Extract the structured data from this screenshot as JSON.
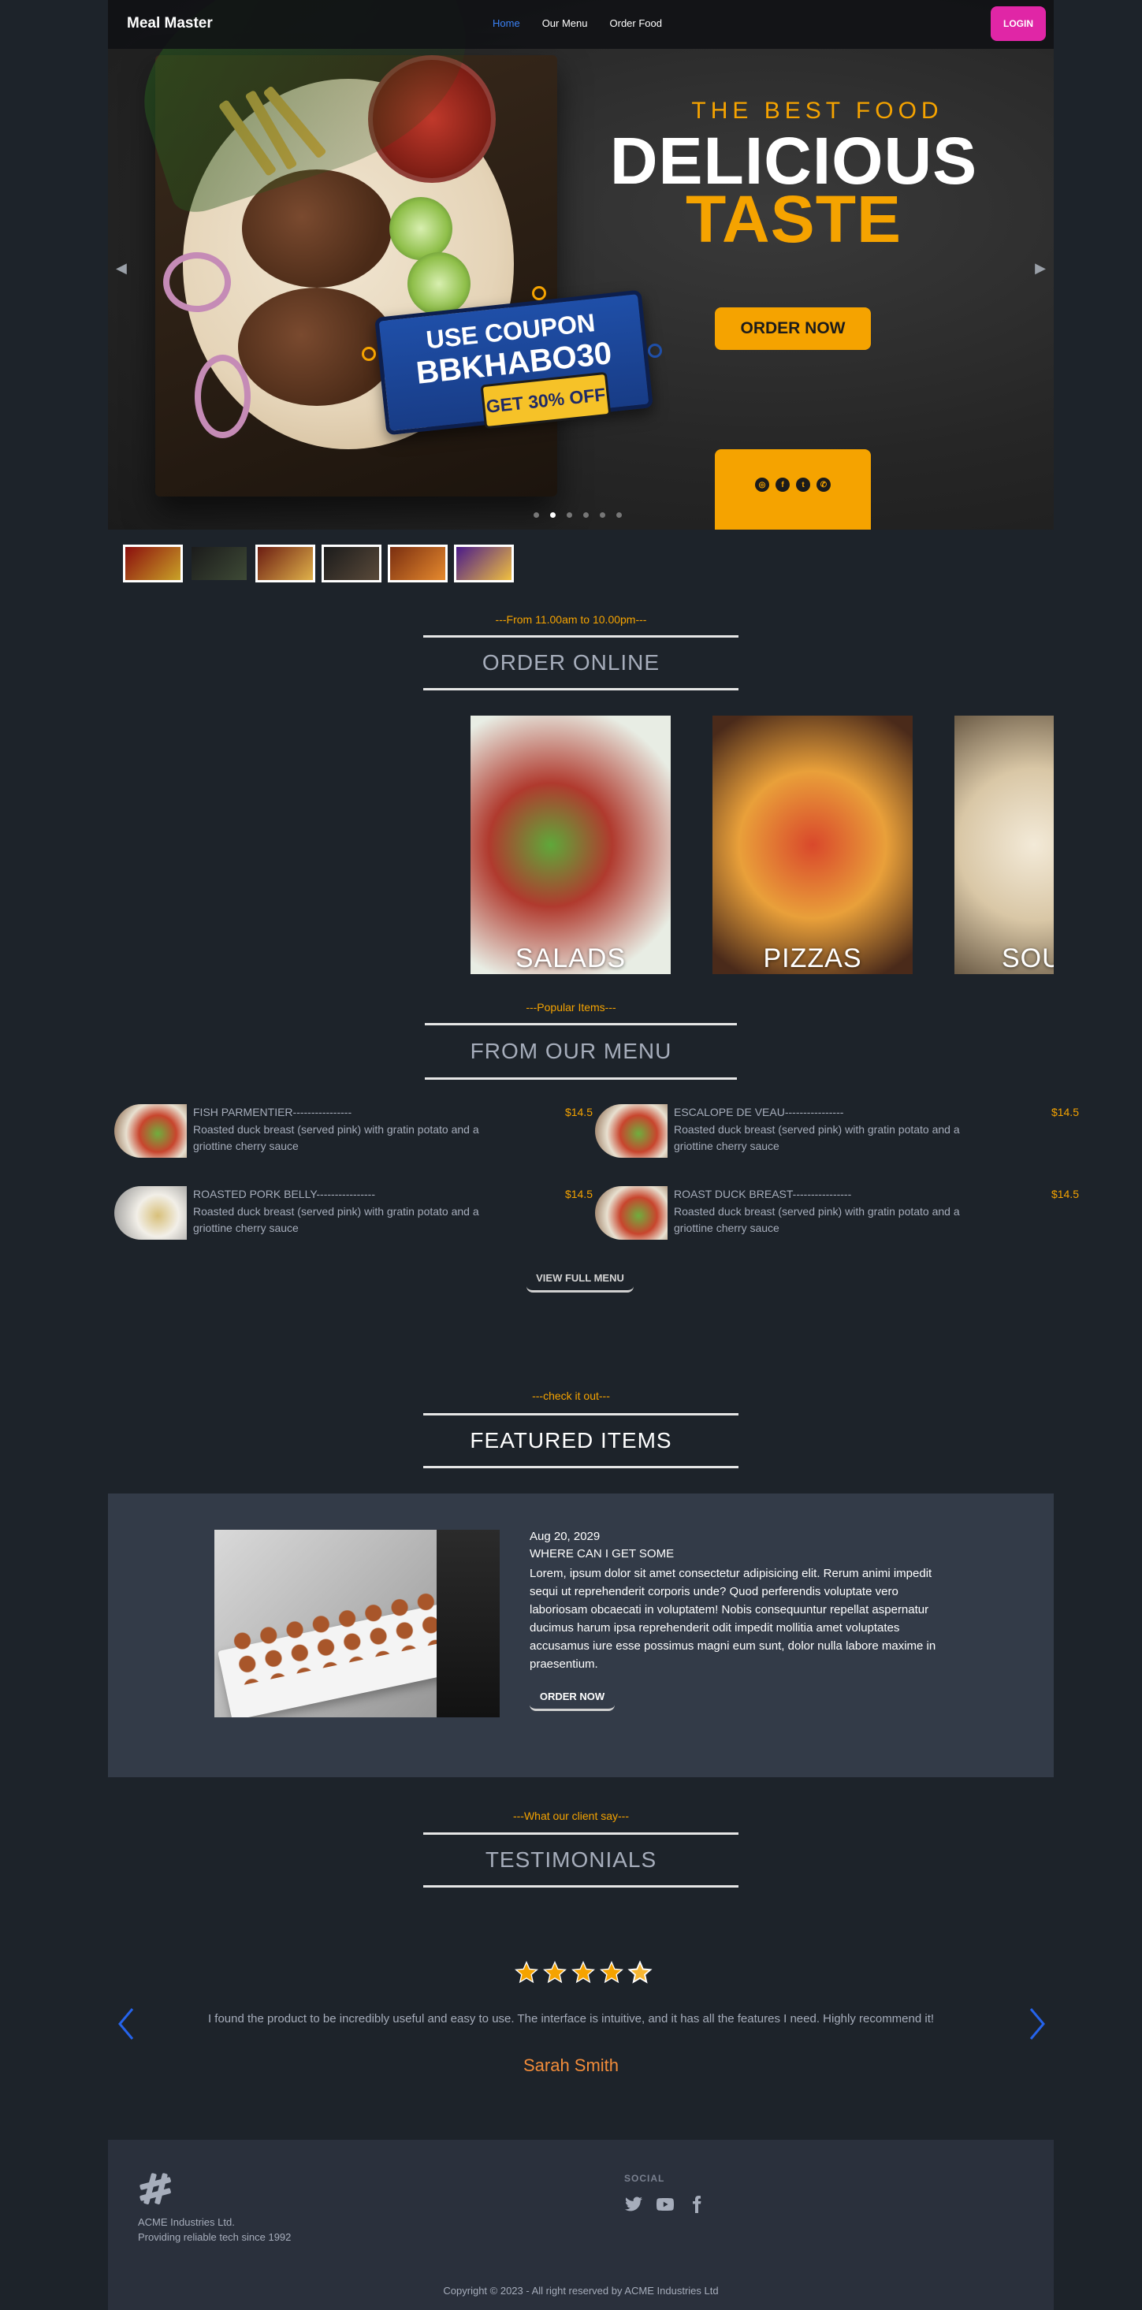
{
  "nav": {
    "brand": "Meal Master",
    "links": [
      "Home",
      "Our Menu",
      "Order Food"
    ],
    "login": "LOGIN"
  },
  "hero": {
    "subtitle": "THE BEST FOOD",
    "title1": "DELICIOUS",
    "title2": "TASTE",
    "coupon_line1": "USE COUPON",
    "coupon_code": "BBKHABO30",
    "coupon_offer": "GET 30% OFF",
    "cta": "ORDER NOW",
    "social_icons": [
      "instagram-icon",
      "facebook-icon",
      "twitter-icon",
      "whatsapp-icon"
    ],
    "slides_total": 6,
    "active_slide": 2
  },
  "thumbnails": 6,
  "order_section": {
    "tag": "---From 11.00am to 10.00pm---",
    "title": "ORDER ONLINE",
    "categories": [
      "SALADS",
      "PIZZAS",
      "SOUPS"
    ]
  },
  "menu_section": {
    "tag": "---Popular Items---",
    "title": "FROM OUR MENU",
    "items": [
      {
        "name": "FISH PARMENTIER----------------",
        "desc": "Roasted duck breast (served pink) with gratin potato and a griottine cherry sauce",
        "price": "$14.5"
      },
      {
        "name": "ESCALOPE DE VEAU----------------",
        "desc": "Roasted duck breast (served pink) with gratin potato and a griottine cherry sauce",
        "price": "$14.5"
      },
      {
        "name": "ROASTED PORK BELLY----------------",
        "desc": "Roasted duck breast (served pink) with gratin potato and a griottine cherry sauce",
        "price": "$14.5"
      },
      {
        "name": "ROAST DUCK BREAST----------------",
        "desc": "Roasted duck breast (served pink) with gratin potato and a griottine cherry sauce",
        "price": "$14.5"
      }
    ],
    "button": "VIEW FULL MENU"
  },
  "featured_section": {
    "tag": "---check it out---",
    "title": "FEATURED ITEMS",
    "date": "Aug 20, 2029",
    "heading": "WHERE CAN I GET SOME",
    "body": "Lorem, ipsum dolor sit amet consectetur adipisicing elit. Rerum animi impedit sequi ut reprehenderit corporis unde? Quod perferendis voluptate vero laboriosam obcaecati in voluptatem! Nobis consequuntur repellat aspernatur ducimus harum ipsa reprehenderit odit impedit mollitia amet voluptates accusamus iure esse possimus magni eum sunt, dolor nulla labore maxime in praesentium.",
    "button": "ORDER NOW"
  },
  "testimonial_section": {
    "tag": "---What our client say---",
    "title": "TESTIMONIALS",
    "rating": 5,
    "quote": "I found the product to be incredibly useful and easy to use. The interface is intuitive, and it has all the features I need. Highly recommend it!",
    "author": "Sarah Smith"
  },
  "footer": {
    "company": "ACME Industries Ltd.",
    "tagline": "Providing reliable tech since 1992",
    "social_title": "SOCIAL",
    "social_icons": [
      "twitter-icon",
      "youtube-icon",
      "facebook-icon"
    ],
    "copyright": "Copyright © 2023 - All right reserved by ACME Industries Ltd"
  },
  "colors": {
    "background": "#1d232a",
    "accent": "#f5a300",
    "primary_link": "#3b82f6",
    "login": "#e026a6",
    "featured_bg": "#333b48",
    "footer_bg": "#2a303c"
  }
}
